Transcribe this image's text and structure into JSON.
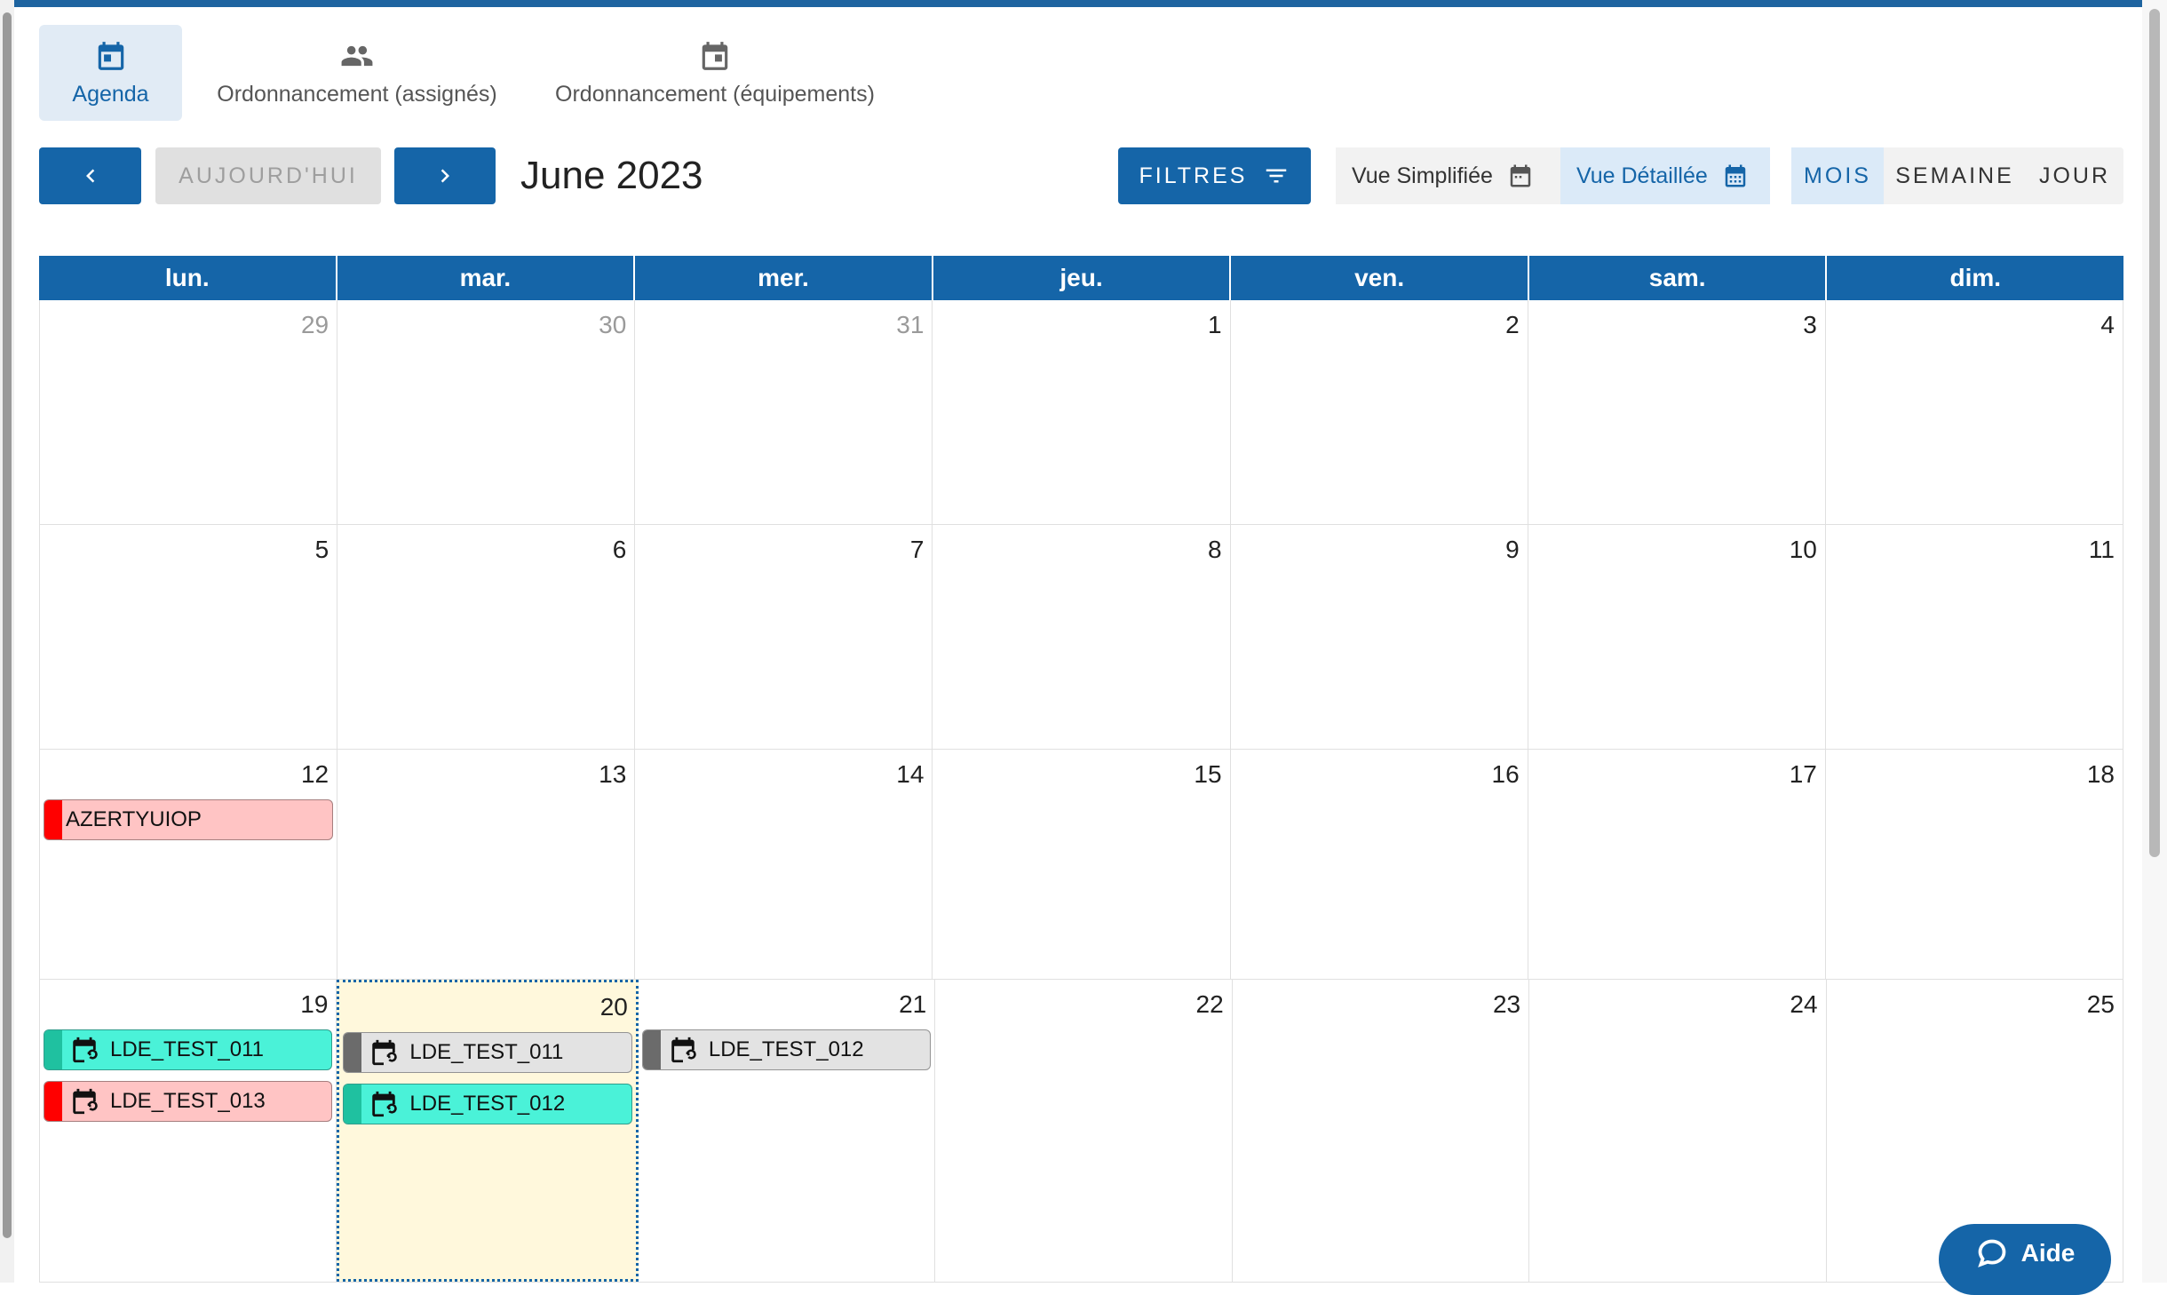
{
  "colors": {
    "primary": "#1565a8",
    "today_bg": "#fff8dc",
    "event_red": "#ff0000",
    "event_red_bg": "#ffc4c4",
    "event_teal": "#1fc1a0",
    "event_teal_bg": "#4af2d8",
    "event_grey": "#6b6b6b",
    "event_grey_bg": "#e3e3e3"
  },
  "tabs": [
    {
      "label": "Agenda",
      "icon": "calendar-icon",
      "active": true
    },
    {
      "label": "Ordonnancement (assignés)",
      "icon": "people-icon",
      "active": false
    },
    {
      "label": "Ordonnancement (équipements)",
      "icon": "calendar-icon",
      "active": false
    }
  ],
  "toolbar": {
    "prev_icon": "chevron-left-icon",
    "today_label": "AUJOURD'HUI",
    "next_icon": "chevron-right-icon",
    "month_title": "June 2023",
    "filters_label": "FILTRES",
    "vue_simple_label": "Vue Simplifiée",
    "vue_detail_label": "Vue Détaillée",
    "range_month": "MOIS",
    "range_week": "SEMAINE",
    "range_day": "JOUR",
    "active_range": "MOIS"
  },
  "calendar": {
    "weekdays": [
      "lun.",
      "mar.",
      "mer.",
      "jeu.",
      "ven.",
      "sam.",
      "dim."
    ],
    "weeks": [
      {
        "days": [
          {
            "num": "29",
            "other": true,
            "events": []
          },
          {
            "num": "30",
            "other": true,
            "events": []
          },
          {
            "num": "31",
            "other": true,
            "events": []
          },
          {
            "num": "1",
            "events": []
          },
          {
            "num": "2",
            "events": []
          },
          {
            "num": "3",
            "events": []
          },
          {
            "num": "4",
            "events": []
          }
        ]
      },
      {
        "days": [
          {
            "num": "5",
            "events": []
          },
          {
            "num": "6",
            "events": []
          },
          {
            "num": "7",
            "events": []
          },
          {
            "num": "8",
            "events": []
          },
          {
            "num": "9",
            "events": []
          },
          {
            "num": "10",
            "events": []
          },
          {
            "num": "11",
            "events": []
          }
        ]
      },
      {
        "days": [
          {
            "num": "12",
            "events": [
              {
                "label": "AZERTYUIOP",
                "color": "red",
                "icon": null
              }
            ]
          },
          {
            "num": "13",
            "events": []
          },
          {
            "num": "14",
            "events": []
          },
          {
            "num": "15",
            "events": []
          },
          {
            "num": "16",
            "events": []
          },
          {
            "num": "17",
            "events": []
          },
          {
            "num": "18",
            "events": []
          }
        ]
      },
      {
        "days": [
          {
            "num": "19",
            "events": [
              {
                "label": "LDE_TEST_011",
                "color": "teal",
                "icon": "calendar-sync-icon"
              },
              {
                "label": "LDE_TEST_013",
                "color": "red",
                "icon": "calendar-sync-icon"
              }
            ]
          },
          {
            "num": "20",
            "today": true,
            "events": [
              {
                "label": "LDE_TEST_011",
                "color": "grey",
                "icon": "calendar-sync-icon"
              },
              {
                "label": "LDE_TEST_012",
                "color": "teal",
                "icon": "calendar-sync-icon"
              }
            ]
          },
          {
            "num": "21",
            "events": [
              {
                "label": "LDE_TEST_012",
                "color": "grey",
                "icon": "calendar-sync-icon"
              }
            ]
          },
          {
            "num": "22",
            "events": []
          },
          {
            "num": "23",
            "events": []
          },
          {
            "num": "24",
            "events": []
          },
          {
            "num": "25",
            "events": []
          }
        ]
      }
    ]
  },
  "help": {
    "label": "Aide",
    "icon": "chat-bubble-icon"
  }
}
